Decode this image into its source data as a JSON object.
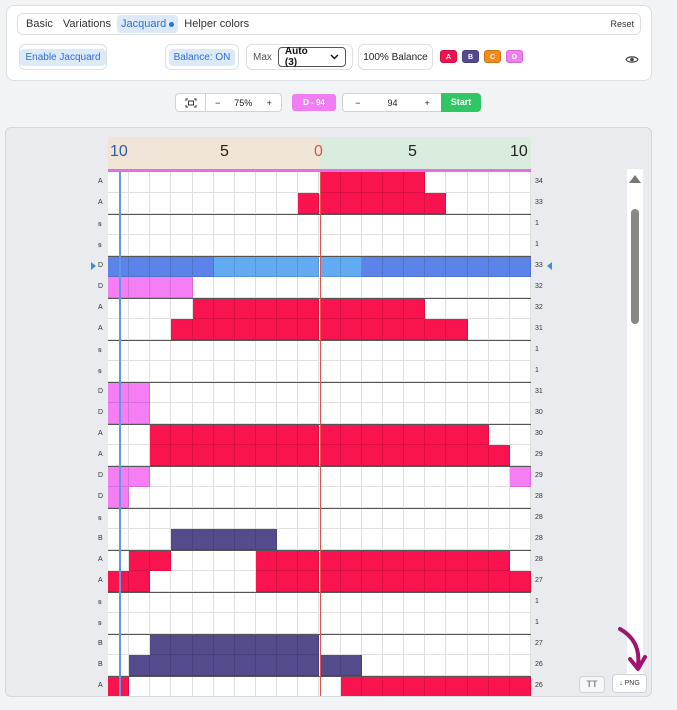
{
  "tabs": [
    {
      "label": "Basic",
      "active": false
    },
    {
      "label": "Variations",
      "active": false
    },
    {
      "label": "Jacquard",
      "active": true
    },
    {
      "label": "Helper colors",
      "active": false
    }
  ],
  "reset_label": "Reset",
  "enable_jacquard_label": "Enable Jacquard",
  "balance_label": "Balance: ON",
  "max_label": "Max",
  "max_value": "Auto (3)",
  "balance100_label": "100% Balance",
  "color_chips": [
    {
      "letter": "A",
      "color": "#f0134f"
    },
    {
      "letter": "B",
      "color": "#554b8c"
    },
    {
      "letter": "C",
      "color": "#f08a1a"
    },
    {
      "letter": "D",
      "color": "#f07ef0"
    }
  ],
  "toolbar": {
    "zoom": "75%",
    "minus": "−",
    "plus": "+",
    "row_badge": "D - 94",
    "row_value": "94",
    "start_label": "Start"
  },
  "ruler": {
    "left_labels": [
      "10",
      "5"
    ],
    "center_label": "0",
    "right_labels": [
      "5",
      "10"
    ]
  },
  "colors": {
    "A": "#f9134f",
    "B": "#544b8c",
    "D": "#f57ef5",
    "highlight_dark": "#5c84e8",
    "highlight_light": "#62aaf2",
    "center_line": "#e0524a",
    "blue_line": "#5a9be8"
  },
  "rows": [
    {
      "left": "A",
      "right": "34",
      "cells": "..........AAAAA........."
    },
    {
      "left": "A",
      "right": "33",
      "cells": ".........AAAAAAA........"
    },
    {
      "left": "ꞩ",
      "right": "1",
      "cells": "........................"
    },
    {
      "left": "ꞩ",
      "right": "1",
      "cells": "........................"
    },
    {
      "left": "D",
      "right": "33",
      "cells": "HHHHHLLLLLLLHHHHHHHHHHHH",
      "highlight": true
    },
    {
      "left": "D",
      "right": "32",
      "cells": "DDDD....................DDDDDD"
    },
    {
      "left": "A",
      "right": "32",
      "cells": "....AAAAAAAAAAA.........."
    },
    {
      "left": "A",
      "right": "31",
      "cells": "...AAAAAAAAAAAAAA........"
    },
    {
      "left": "ꞩ",
      "right": "1",
      "cells": "........................"
    },
    {
      "left": "ꞩ",
      "right": "1",
      "cells": "........................"
    },
    {
      "left": "D",
      "right": "31",
      "cells": "DD..................DDD"
    },
    {
      "left": "D",
      "right": "30",
      "cells": "DD...................DDDD"
    },
    {
      "left": "A",
      "right": "30",
      "cells": "..AAAAAAAAAAAAAAAA......."
    },
    {
      "left": "A",
      "right": "29",
      "cells": "..AAAAAAAAAAAAAAAAA......"
    },
    {
      "left": "D",
      "right": "29",
      "cells": "DD.................DD"
    },
    {
      "left": "D",
      "right": "28",
      "cells": "D...................D"
    },
    {
      "left": "ꞩ",
      "right": "28",
      "cells": "........................"
    },
    {
      "left": "B",
      "right": "28",
      "cells": "...BBBBB................"
    },
    {
      "left": "A",
      "right": "28",
      "cells": ".AA....AAAAAAAAAAAA....."
    },
    {
      "left": "A",
      "right": "27",
      "cells": "AA.....AAAAAAAAAAAAAAAA."
    },
    {
      "left": "ꞩ",
      "right": "1",
      "cells": "........................"
    },
    {
      "left": "ꞩ",
      "right": "1",
      "cells": "........................"
    },
    {
      "left": "B",
      "right": "27",
      "cells": "..BBBBBBBB..............."
    },
    {
      "left": "B",
      "right": "26",
      "cells": ".BBBBBBBBBBB............"
    },
    {
      "left": "A",
      "right": "26",
      "cells": "A..........AAAAAAAAA...."
    }
  ],
  "tt_label": "TT",
  "png_label": "↓ PNG"
}
